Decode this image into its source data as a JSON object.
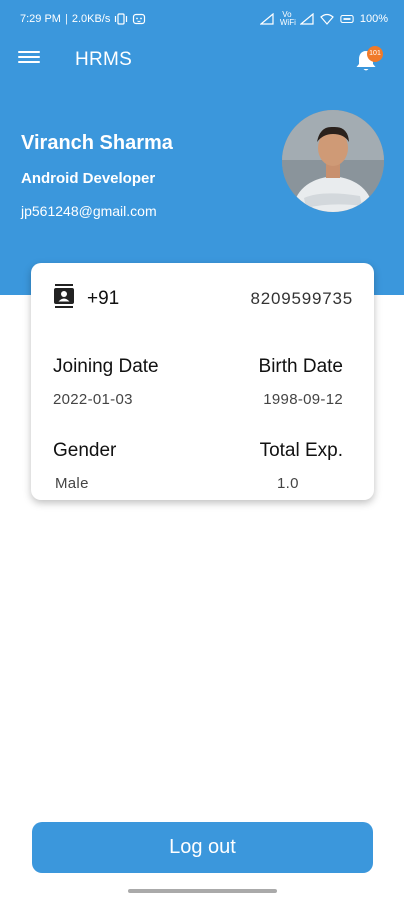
{
  "status_bar": {
    "time": "7:29 PM",
    "separator": "|",
    "speed": "2.0KB/s",
    "vowifi": "Vo\nWiFi",
    "battery": "100"
  },
  "toolbar": {
    "title": "HRMS",
    "menu_icon": "hamburger-menu-icon",
    "notification_icon": "bell-icon",
    "notification_count": "101"
  },
  "profile": {
    "name": "Viranch Sharma",
    "role": "Android Developer",
    "email": "jp561248@gmail.com"
  },
  "card": {
    "phone_icon": "contact-card-icon",
    "phone_code": "+91",
    "phone_number": "8209599735",
    "joining_label": "Joining Date",
    "joining_value": "2022-01-03",
    "birth_label": "Birth Date",
    "birth_value": "1998-09-12",
    "gender_label": "Gender",
    "gender_value": "Male",
    "exp_label": "Total Exp.",
    "exp_value": "1.0"
  },
  "logout_label": "Log out",
  "colors": {
    "primary": "#3b97dc",
    "badge": "#f07a2a"
  }
}
